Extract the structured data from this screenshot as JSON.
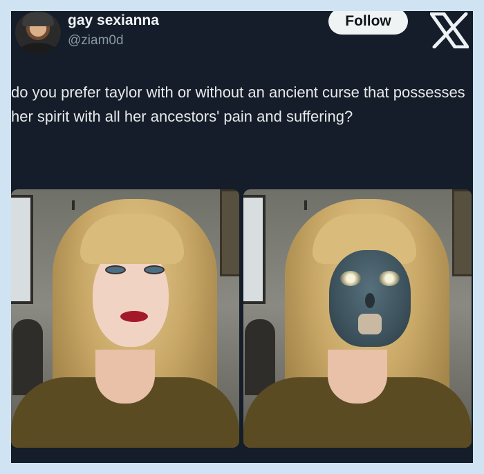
{
  "author": {
    "display_name": "gay sexianna",
    "handle": "@ziam0d",
    "avatar_icon": "user-avatar"
  },
  "follow_button": {
    "label": "Follow"
  },
  "platform_logo": {
    "icon": "x-logo-icon"
  },
  "tweet": {
    "text": "do you prefer taylor with or without an ancient curse that possesses her spirit with all her ancestors' pain and suffering?"
  },
  "media": [
    {
      "description_icon": "photo-original"
    },
    {
      "description_icon": "photo-cursed-mask"
    }
  ],
  "colors": {
    "page_background": "#cfe3f2",
    "card_background": "#141d29",
    "primary_text": "#e7e9ea",
    "secondary_text": "#8b98a5",
    "follow_button_bg": "#eff3f4"
  }
}
